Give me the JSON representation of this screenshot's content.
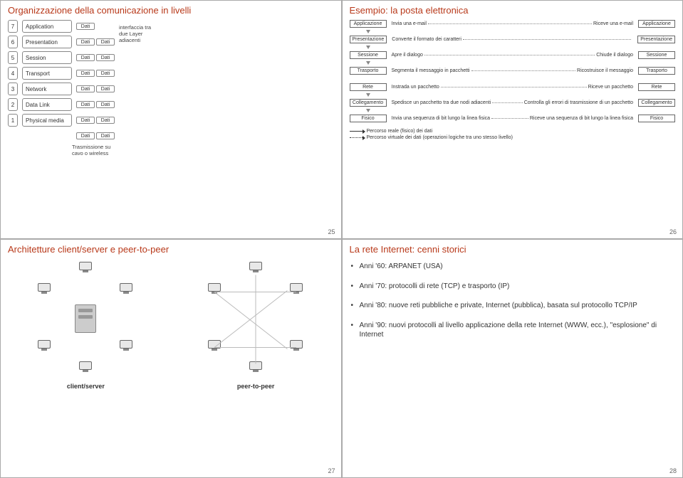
{
  "slides": {
    "s25": {
      "title": "Organizzazione della comunicazione in livelli",
      "num": "25",
      "nums": [
        "7",
        "6",
        "5",
        "4",
        "3",
        "2",
        "1"
      ],
      "layers": [
        "Application",
        "Presentation",
        "Session",
        "Transport",
        "Network",
        "Data Link",
        "Physical media"
      ],
      "dati": "Dati",
      "note_top1": "interfaccia tra",
      "note_top2": "due Layer",
      "note_top3": "adiacenti",
      "note_bottom1": "Trasmissione su",
      "note_bottom2": "cavo o wireless"
    },
    "s26": {
      "title": "Esempio: la posta elettronica",
      "num": "26",
      "rows": [
        {
          "box": "Applicazione",
          "left": "Invia una e-mail",
          "right": "Riceve una e-mail",
          "box2": "Applicazione"
        },
        {
          "box": "Presentazione",
          "left": "Converte il formato dei caratteri",
          "right": "",
          "box2": "Presentazione"
        },
        {
          "box": "Sessione",
          "left": "Apre il dialogo",
          "right": "Chiude il dialogo",
          "box2": "Sessione"
        },
        {
          "box": "Trasporto",
          "left": "Segmenta il messaggio in pacchetti",
          "right": "Ricostruisce il messaggio",
          "box2": "Trasporto"
        },
        {
          "box": "Rete",
          "left": "Instrada un pacchetto",
          "right": "Riceve un pacchetto",
          "box2": "Rete"
        },
        {
          "box": "Collegamento",
          "left": "Spedisce un pacchetto tra due nodi adiacenti",
          "right": "Controlla gli errori di trasmissione di un pacchetto",
          "box2": "Collegamento"
        },
        {
          "box": "Fisico",
          "left": "Invia una sequenza di bit lungo la linea fisica",
          "right": "Riceve una sequenza di bit lungo la linea fisica",
          "box2": "Fisico"
        }
      ],
      "legend_real": "Percorso reale (fisico) dei dati",
      "legend_real_em": "reale",
      "legend_virt": "Percorso virtuale dei dati (operazioni logiche tra uno stesso livello)",
      "legend_virt_em": "virtuale"
    },
    "s27": {
      "title": "Architetture client/server e peer-to-peer",
      "num": "27",
      "label_cs": "client/server",
      "label_p2p": "peer-to-peer"
    },
    "s28": {
      "title": "La rete Internet: cenni storici",
      "num": "28",
      "bullets": [
        "Anni '60: ARPANET (USA)",
        "Anni '70: protocolli di rete (TCP) e trasporto (IP)",
        "Anni '80: nuove reti pubbliche e private, Internet (pubblica), basata sul protocollo TCP/IP",
        "Anni '90: nuovi protocolli al livello applicazione della rete Internet (WWW, ecc.), \"esplosione\" di Internet"
      ]
    }
  }
}
